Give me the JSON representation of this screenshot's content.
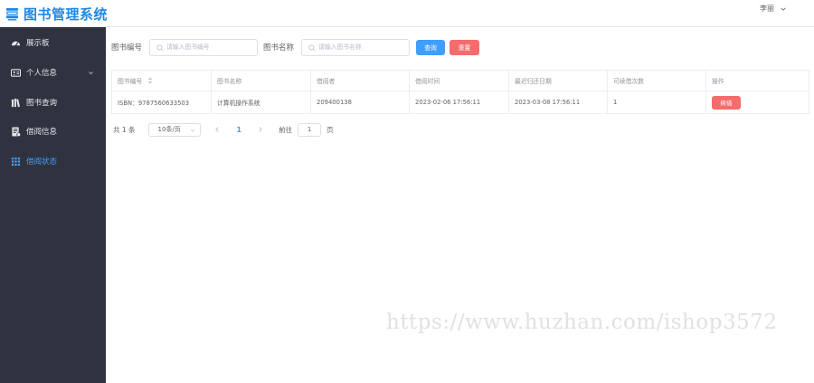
{
  "app": {
    "title": "图书管理系统",
    "user_name": "李丽",
    "accent_color": "#409eff",
    "brand_color": "#1e88e5"
  },
  "sidebar": {
    "items": [
      {
        "label": "展示板",
        "icon": "dashboard-icon"
      },
      {
        "label": "个人信息",
        "icon": "id-card-icon",
        "has_submenu": true
      },
      {
        "label": "图书查询",
        "icon": "books-icon"
      },
      {
        "label": "借阅信息",
        "icon": "document-icon"
      },
      {
        "label": "借阅状态",
        "icon": "grid-icon",
        "active": true
      }
    ]
  },
  "search": {
    "book_no_label": "图书编号",
    "book_no_placeholder": "请输入图书编号",
    "book_name_label": "图书名称",
    "book_name_placeholder": "请输入图书名称",
    "search_label": "查询",
    "reset_label": "重置"
  },
  "table": {
    "headers": [
      "图书编号",
      "图书名称",
      "借阅者",
      "借阅时间",
      "最迟归还日期",
      "可续借次数",
      "操作"
    ],
    "rows": [
      {
        "book_no": "ISBN：9787560633503",
        "book_name": "计算机操作系统",
        "borrower": "209400138",
        "borrow_time": "2023-02-06 17:56:11",
        "due_date": "2023-03-08 17:56:11",
        "renew_count": "1",
        "action_label": "续借"
      }
    ]
  },
  "pagination": {
    "total": "共 1 条",
    "page_size": "10条/页",
    "current_page": "1",
    "goto_label": "前往",
    "goto_value": "1",
    "page_suffix": "页"
  },
  "watermark": "https://www.huzhan.com/ishop3572"
}
